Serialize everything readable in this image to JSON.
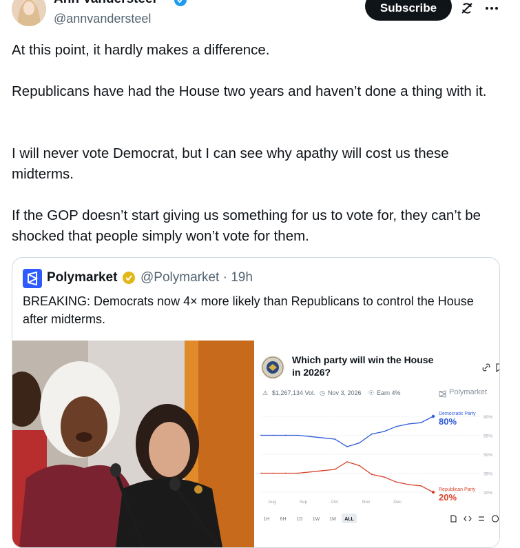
{
  "author": {
    "display_name": "Ann Vandersteel",
    "handle": "@annvandersteel"
  },
  "actions": {
    "subscribe_label": "Subscribe",
    "grok_icon": "grok-icon",
    "more_icon": "more-icon"
  },
  "post": {
    "paragraphs": [
      "At this point, it hardly makes a difference.",
      "Republicans have had the House two years and haven’t done a thing with it.",
      "I will never vote Democrat, but I can see why apathy will cost us these midterms.",
      "If the GOP doesn’t start giving us something for us to vote for, they can’t be shocked that people simply won’t vote for them."
    ]
  },
  "quote": {
    "name": "Polymarket",
    "handle_time": "@Polymarket · 19h",
    "text": "BREAKING: Democrats now 4× more likely than Republicans to control the House after midterms."
  },
  "market": {
    "title_line1": "Which party will win the House",
    "title_line2": "in 2026?",
    "volume": "$1,267,134 Vol.",
    "date": "Nov 3, 2026",
    "earn": "Earn 4%",
    "brand": "Polymarket",
    "range_buttons": [
      "1H",
      "6H",
      "1D",
      "1W",
      "1M",
      "ALL"
    ],
    "selected_range": "ALL",
    "colors": {
      "democratic": "#2e5bd6",
      "republican": "#d9432b"
    }
  },
  "chart_data": {
    "type": "line",
    "x_labels": [
      "Aug",
      "Sep",
      "Oct",
      "Nov",
      "Dec"
    ],
    "y_ticks": [
      "80%",
      "65%",
      "50%",
      "35%",
      "20%"
    ],
    "ylim": [
      20,
      80
    ],
    "series": [
      {
        "name": "Democratic Party",
        "current_label": "80%",
        "values": [
          65,
          65,
          65,
          65,
          64,
          63,
          62,
          56,
          59,
          66,
          68,
          72,
          74,
          75,
          80
        ]
      },
      {
        "name": "Republican Party",
        "current_label": "20%",
        "values": [
          35,
          35,
          35,
          35,
          36,
          37,
          38,
          44,
          41,
          34,
          32,
          28,
          26,
          25,
          20
        ]
      }
    ]
  }
}
